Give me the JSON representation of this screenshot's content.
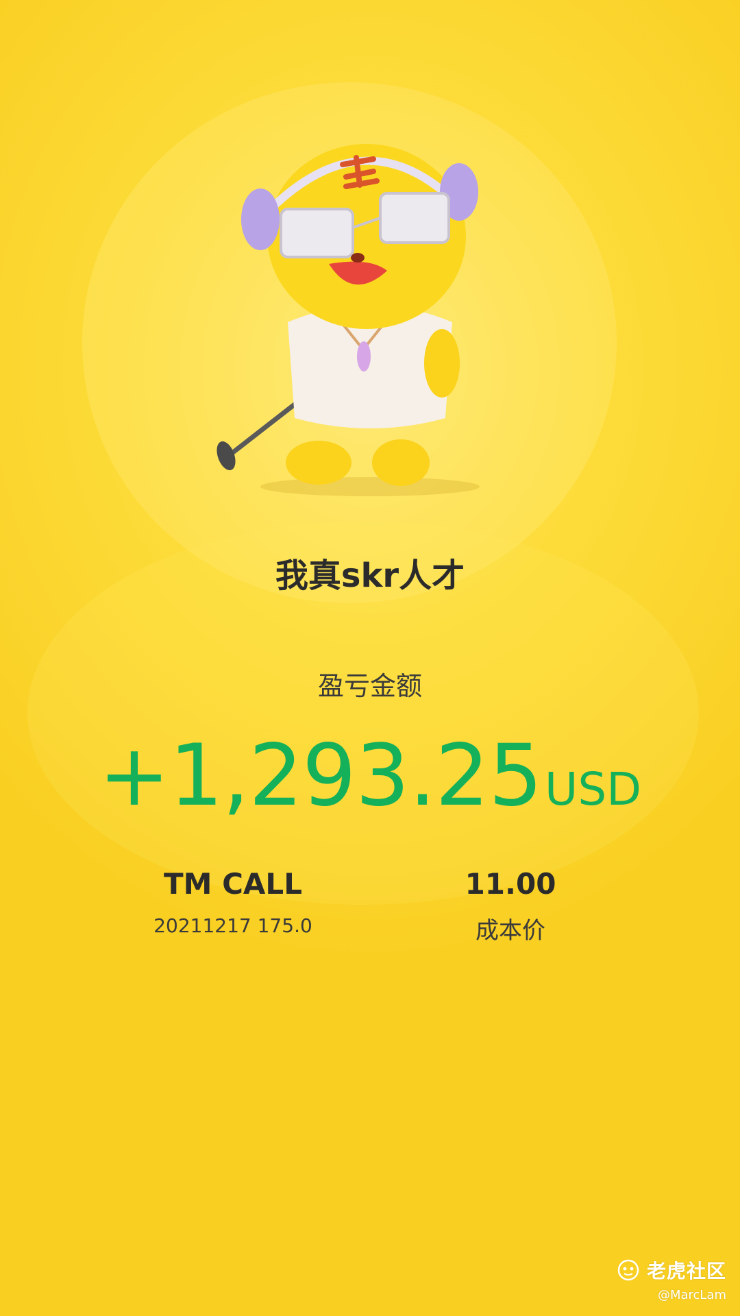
{
  "card": {
    "title": "我真skr人才",
    "pnl_label": "盈亏金额",
    "pnl_value": "+1,293.25",
    "pnl_currency": "USD",
    "position_name": "TM CALL",
    "position_detail": "20211217 175.0",
    "cost_value": "11.00",
    "cost_label": "成本价"
  },
  "watermark": {
    "brand": "老虎社区",
    "user": "@MarcLam"
  },
  "colors": {
    "background": "#fad52b",
    "profit_green": "#14b05a",
    "text_dark": "#2b2b2b"
  },
  "icons": {
    "mascot": "tiger-mascot-with-headphones-microphone",
    "watermark_logo": "tiger-logo-icon"
  }
}
